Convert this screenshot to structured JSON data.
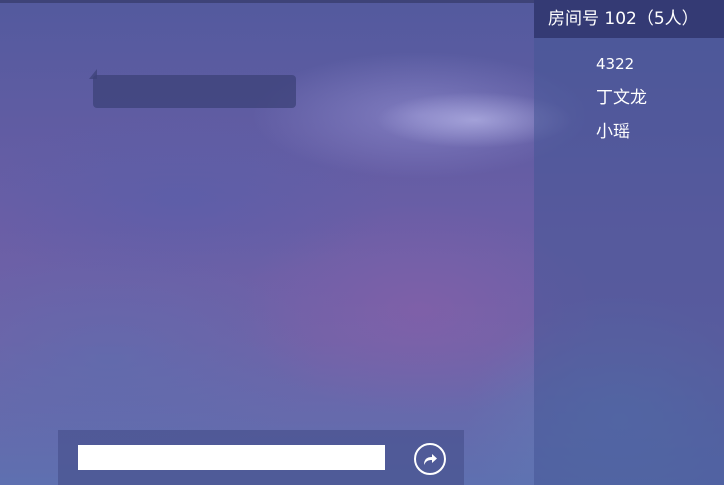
{
  "room": {
    "title": "房间号 102（5人）"
  },
  "users": [
    {
      "name": "4322"
    },
    {
      "name": "丁文龙"
    },
    {
      "name": "小瑶"
    }
  ],
  "chat": {
    "input_value": "",
    "send_icon": "share-arrow-icon"
  }
}
